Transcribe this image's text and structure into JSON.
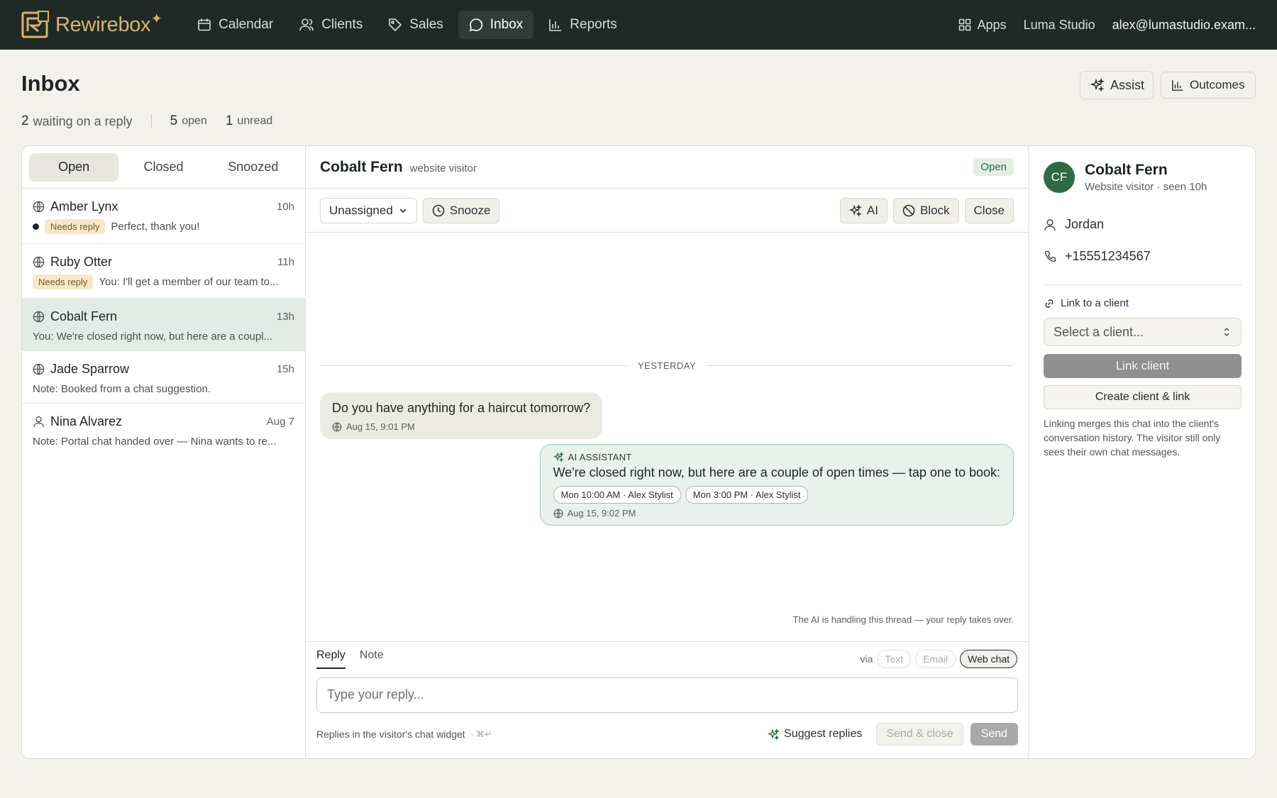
{
  "brand": {
    "name": "Rewirebox",
    "spark": "✦"
  },
  "nav": {
    "items": [
      {
        "label": "Calendar",
        "icon": "calendar-icon"
      },
      {
        "label": "Clients",
        "icon": "users-icon"
      },
      {
        "label": "Sales",
        "icon": "tag-icon"
      },
      {
        "label": "Inbox",
        "icon": "chat-icon",
        "active": true
      },
      {
        "label": "Reports",
        "icon": "bar-chart-icon"
      }
    ],
    "apps_label": "Apps",
    "workspace": "Luma Studio",
    "account": "alex@lumastudio.exam..."
  },
  "page": {
    "title": "Inbox",
    "stats": {
      "waiting_count": "2",
      "waiting_label": "waiting on a reply",
      "open_count": "5",
      "open_label": "open",
      "unread_count": "1",
      "unread_label": "unread"
    },
    "assist_label": "Assist",
    "outcomes_label": "Outcomes"
  },
  "list": {
    "tabs": [
      "Open",
      "Closed",
      "Snoozed"
    ],
    "conversations": [
      {
        "name": "Amber Lynx",
        "time": "10h",
        "badge": "Needs reply",
        "preview": "Perfect, thank you!",
        "unread": true,
        "icon": "globe-icon"
      },
      {
        "name": "Ruby Otter",
        "time": "11h",
        "badge": "Needs reply",
        "preview": "You: I'll get a member of our team to...",
        "icon": "globe-icon"
      },
      {
        "name": "Cobalt Fern",
        "time": "13h",
        "preview": "You: We're closed right now, but here are a coupl...",
        "icon": "globe-icon",
        "selected": true
      },
      {
        "name": "Jade Sparrow",
        "time": "15h",
        "preview": "Note: Booked from a chat suggestion.",
        "icon": "globe-icon"
      },
      {
        "name": "Nina Alvarez",
        "time": "Aug 7",
        "preview": "Note: Portal chat handed over — Nina wants to re...",
        "icon": "person-icon"
      }
    ]
  },
  "chat": {
    "name": "Cobalt Fern",
    "subtitle": "website visitor",
    "status": "Open",
    "assignee": "Unassigned",
    "snooze_label": "Snooze",
    "ai_label": "AI",
    "block_label": "Block",
    "close_label": "Close",
    "day_separator": "YESTERDAY",
    "messages": {
      "incoming": {
        "text": "Do you have anything for a haircut tomorrow?",
        "time": "Aug 15, 9:01 PM"
      },
      "outgoing": {
        "sender": "AI ASSISTANT",
        "text": "We're closed right now, but here are a couple of open times — tap one to book:",
        "slots": [
          "Mon 10:00 AM · Alex Stylist",
          "Mon 3:00 PM · Alex Stylist"
        ],
        "time": "Aug 15, 9:02 PM"
      }
    },
    "ai_note": "The AI is handling this thread — your reply takes over.",
    "composer": {
      "tabs": [
        "Reply",
        "Note"
      ],
      "via_label": "via",
      "channels": [
        "Text",
        "Email",
        "Web chat"
      ],
      "placeholder": "Type your reply...",
      "footer_note": "Replies in the visitor's chat widget",
      "shortcut": "· ⌘↵",
      "suggest_label": "Suggest replies",
      "send_close_label": "Send & close",
      "send_label": "Send"
    }
  },
  "sidebar": {
    "initials": "CF",
    "name": "Cobalt Fern",
    "subtitle": "Website visitor · seen 10h",
    "contact_name": "Jordan",
    "phone": "+15551234567",
    "link_label": "Link to a client",
    "select_placeholder": "Select a client...",
    "link_button": "Link client",
    "create_button": "Create client & link",
    "help": "Linking merges this chat into the client's conversation history. The visitor still only sees their own chat messages."
  },
  "colors": {
    "nav_bg": "#1f2a26",
    "brand": "#d9b36a",
    "accent_green": "#2f6a44",
    "selected_row": "#e2ebe5"
  }
}
